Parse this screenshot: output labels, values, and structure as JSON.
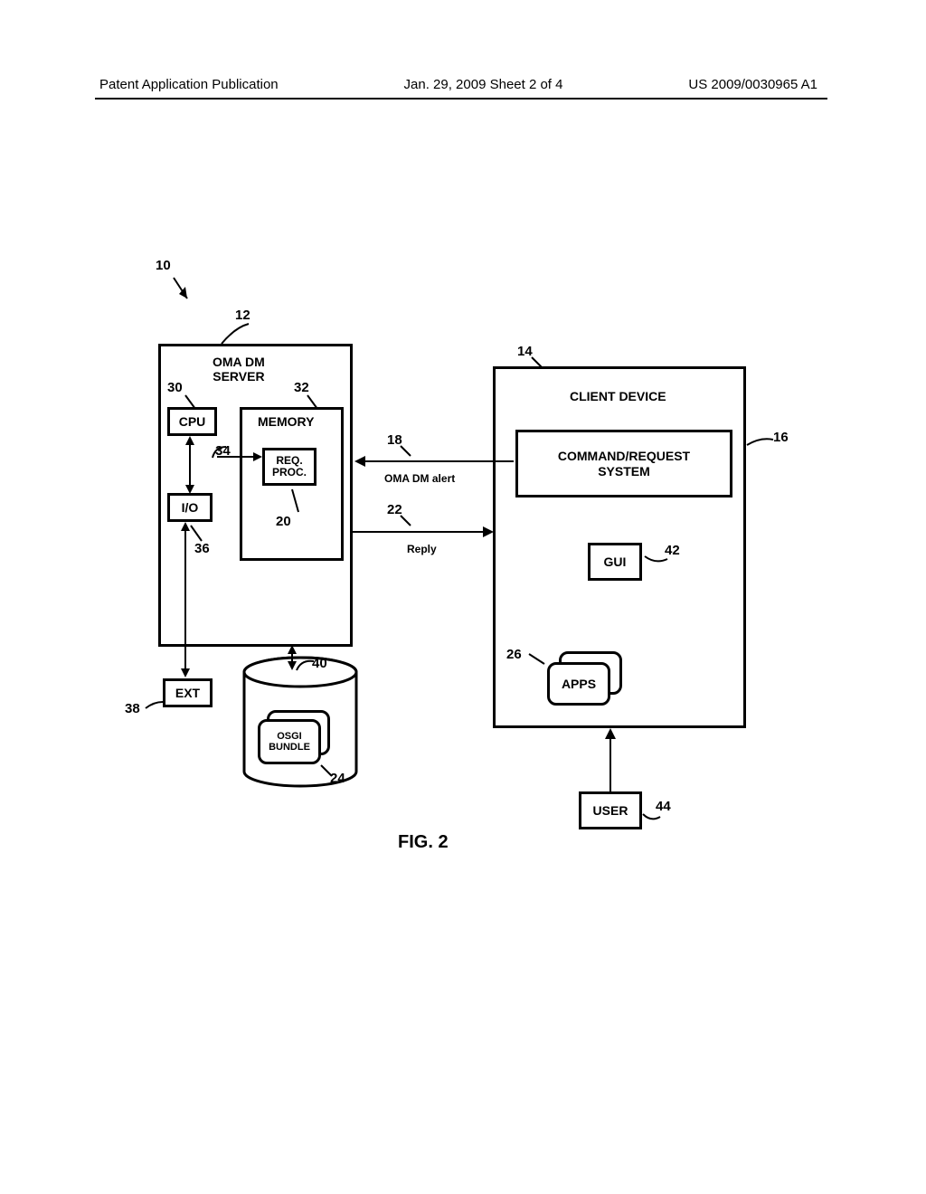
{
  "header": {
    "left": "Patent Application Publication",
    "middle": "Jan. 29, 2009  Sheet 2 of 4",
    "right": "US 2009/0030965 A1"
  },
  "labels": {
    "server_title": "OMA DM\nSERVER",
    "cpu": "CPU",
    "memory": "MEMORY",
    "req_proc": "REQ.\nPROC.",
    "io": "I/O",
    "ext": "EXT",
    "osgi": "OSGI\nBUNDLE",
    "client_title": "CLIENT DEVICE",
    "cmd_req": "COMMAND/REQUEST\nSYSTEM",
    "gui": "GUI",
    "apps": "APPS",
    "user": "USER",
    "alert": "OMA DM alert",
    "reply": "Reply"
  },
  "refs": {
    "r10": "10",
    "r12": "12",
    "r14": "14",
    "r16": "16",
    "r18": "18",
    "r20": "20",
    "r22": "22",
    "r24": "24",
    "r26": "26",
    "r30": "30",
    "r32": "32",
    "r34": "34",
    "r36": "36",
    "r38": "38",
    "r40": "40",
    "r42": "42",
    "r44": "44"
  },
  "caption": "FIG. 2"
}
